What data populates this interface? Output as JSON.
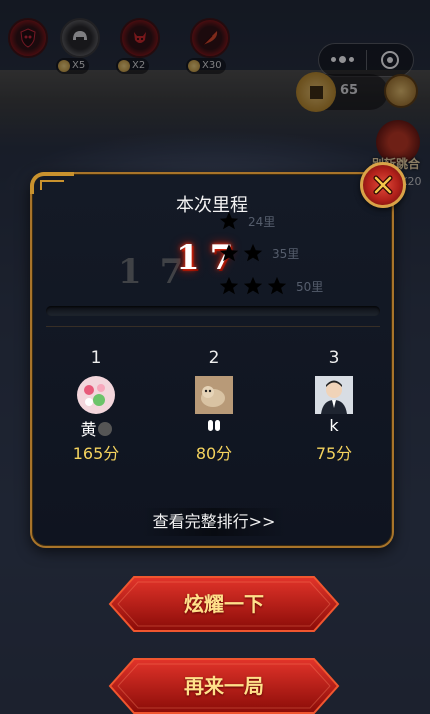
{
  "items": [
    {
      "icon": "shield-skull-icon",
      "count": ""
    },
    {
      "icon": "helmet-icon",
      "count": "X5"
    },
    {
      "icon": "demon-icon",
      "count": "X2"
    },
    {
      "icon": "feather-icon",
      "count": "X30"
    }
  ],
  "coins": {
    "count": "65"
  },
  "share": {
    "label": "别斩跳合",
    "count": "X20"
  },
  "dialog": {
    "title": "本次里程",
    "ghost_distance": "17",
    "distance": "17",
    "stars": [
      {
        "count": 1,
        "label": "24里"
      },
      {
        "count": 2,
        "label": "35里"
      },
      {
        "count": 3,
        "label": "50里"
      }
    ],
    "progress": 0,
    "ranks": [
      {
        "no": "1",
        "name": "黄",
        "score": "165分",
        "avatar": "avatar-flowers"
      },
      {
        "no": "2",
        "name": "",
        "score": "80分",
        "avatar": "avatar-cat"
      },
      {
        "no": "3",
        "name": "k",
        "score": "75分",
        "avatar": "avatar-person"
      }
    ],
    "more_label": "查看完整排行>>"
  },
  "buttons": {
    "show_off": "炫耀一下",
    "replay": "再来一局"
  },
  "colors": {
    "gold_border": "#a8742a",
    "score": "#f4d35e",
    "button_red": "#b3140f",
    "button_text": "#ffe08a"
  }
}
